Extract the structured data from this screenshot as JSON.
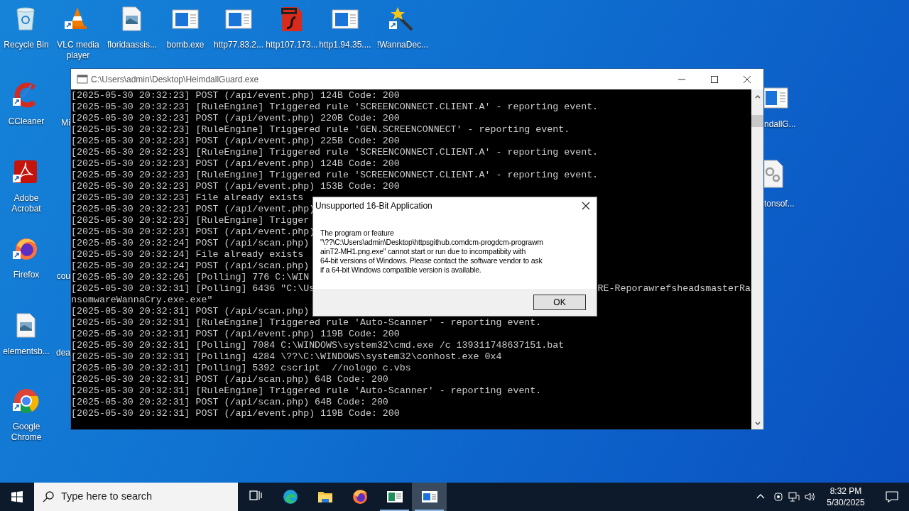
{
  "desktop_icons": [
    {
      "label": "Recycle Bin",
      "kind": "recycle"
    },
    {
      "label": "VLC media player",
      "kind": "vlc"
    },
    {
      "label": "floridaassis...",
      "kind": "image"
    },
    {
      "label": "bomb.exe",
      "kind": "app"
    },
    {
      "label": "http77.83.2...",
      "kind": "app"
    },
    {
      "label": "http107.173...",
      "kind": "pdf"
    },
    {
      "label": "http1.94.35....",
      "kind": "app"
    },
    {
      "label": "!WannaDec...",
      "kind": "wand"
    },
    {
      "label": "CCleaner",
      "kind": "ccleaner"
    },
    {
      "label": "Adobe Acrobat",
      "kind": "acrobat"
    },
    {
      "label": "Firefox",
      "kind": "firefox"
    },
    {
      "label": "elementsb...",
      "kind": "image"
    },
    {
      "label": "Google Chrome",
      "kind": "chrome"
    },
    {
      "label": "Mi",
      "kind": "cut_left"
    },
    {
      "label": "cou",
      "kind": "cut_left"
    },
    {
      "label": "dea",
      "kind": "cut_left"
    },
    {
      "label": "ndallG...",
      "kind": "app_cut"
    },
    {
      "label": "tonsof...",
      "kind": "gear_cut"
    }
  ],
  "console_window": {
    "title": "C:\\Users\\admin\\Desktop\\HeimdallGuard.exe",
    "lines": [
      {
        "text": "[2025-05-30 20:32:23] POST (/api/event.php) 124B Code: 200"
      },
      {
        "text": "[2025-05-30 20:32:23] [RuleEngine] Triggered rule 'SCREENCONNECT.CLIENT.A' - reporting event."
      },
      {
        "text": "[2025-05-30 20:32:23] POST (/api/event.php) 220B Code: 200"
      },
      {
        "text": "[2025-05-30 20:32:23] [RuleEngine] Triggered rule 'GEN.SCREENCONNECT' - reporting event."
      },
      {
        "text": "[2025-05-30 20:32:23] POST (/api/event.php) 225B Code: 200"
      },
      {
        "text": "[2025-05-30 20:32:23] [RuleEngine] Triggered rule 'SCREENCONNECT.CLIENT.A' - reporting event."
      },
      {
        "text": "[2025-05-30 20:32:23] POST (/api/event.php) 124B Code: 200"
      },
      {
        "text": "[2025-05-30 20:32:23] [RuleEngine] Triggered rule 'SCREENCONNECT.CLIENT.A' - reporting event."
      },
      {
        "text": "[2025-05-30 20:32:23] POST (/api/event.php) 153B Code: 200"
      },
      {
        "text": "[2025-05-30 20:32:23] File already exists"
      },
      {
        "text": "[2025-05-30 20:32:23] POST (/api/event.php)"
      },
      {
        "text": "[2025-05-30 20:32:23] [RuleEngine] Trigger"
      },
      {
        "text": "[2025-05-30 20:32:23] POST (/api/event.php)"
      },
      {
        "text": "[2025-05-30 20:32:24] POST (/api/scan.php)"
      },
      {
        "text": "[2025-05-30 20:32:24] File already exists"
      },
      {
        "text": "[2025-05-30 20:32:24] POST (/api/scan.php)"
      },
      {
        "text": "[2025-05-30 20:32:26] [Polling] 776 C:\\WIN"
      },
      {
        "text": "[2025-05-30 20:32:31] [Polling] 6436 \"C:\\Us",
        "right": "RE-ReporawrefsheadsmasterRa"
      },
      {
        "text": "nsomwareWannaCry.exe.exe\""
      },
      {
        "text": "[2025-05-30 20:32:31] POST (/api/scan.php)"
      },
      {
        "text": "[2025-05-30 20:32:31] [RuleEngine] Triggered rule 'Auto-Scanner' - reporting event."
      },
      {
        "text": "[2025-05-30 20:32:31] POST (/api/event.php) 119B Code: 200"
      },
      {
        "text": "[2025-05-30 20:32:31] [Polling] 7084 C:\\WINDOWS\\system32\\cmd.exe /c 139311748637151.bat"
      },
      {
        "text": "[2025-05-30 20:32:31] [Polling] 4284 \\??\\C:\\WINDOWS\\system32\\conhost.exe 0x4"
      },
      {
        "text": "[2025-05-30 20:32:31] [Polling] 5392 cscript  //nologo c.vbs"
      },
      {
        "text": "[2025-05-30 20:32:31] POST (/api/scan.php) 64B Code: 200"
      },
      {
        "text": "[2025-05-30 20:32:31] [RuleEngine] Triggered rule 'Auto-Scanner' - reporting event."
      },
      {
        "text": "[2025-05-30 20:32:31] POST (/api/scan.php) 64B Code: 200"
      },
      {
        "text": "[2025-05-30 20:32:31] POST (/api/event.php) 119B Code: 200"
      }
    ]
  },
  "dialog": {
    "title": "Unsupported 16-Bit Application",
    "message_lines": [
      "The program or feature",
      "\"\\??\\C:\\Users\\admin\\Desktop\\httpsgithub.comdcm-progdcm-prograwm",
      "ainT2-MH1.png.exe\" cannot start or run due to incompatibity with",
      "64-bit versions of Windows. Please contact the software vendor to ask",
      "if a 64-bit Windows compatible version is available."
    ],
    "button": "OK"
  },
  "taskbar": {
    "search_placeholder": "Type here to search",
    "apps": [
      {
        "kind": "taskview",
        "running": false,
        "active": false
      },
      {
        "kind": "edge",
        "running": false,
        "active": false
      },
      {
        "kind": "folder",
        "running": false,
        "active": false
      },
      {
        "kind": "firefox",
        "running": false,
        "active": false
      },
      {
        "kind": "app",
        "running": true,
        "active": false
      },
      {
        "kind": "console",
        "running": true,
        "active": true
      }
    ],
    "time": "8:32 PM",
    "date": "5/30/2025"
  }
}
